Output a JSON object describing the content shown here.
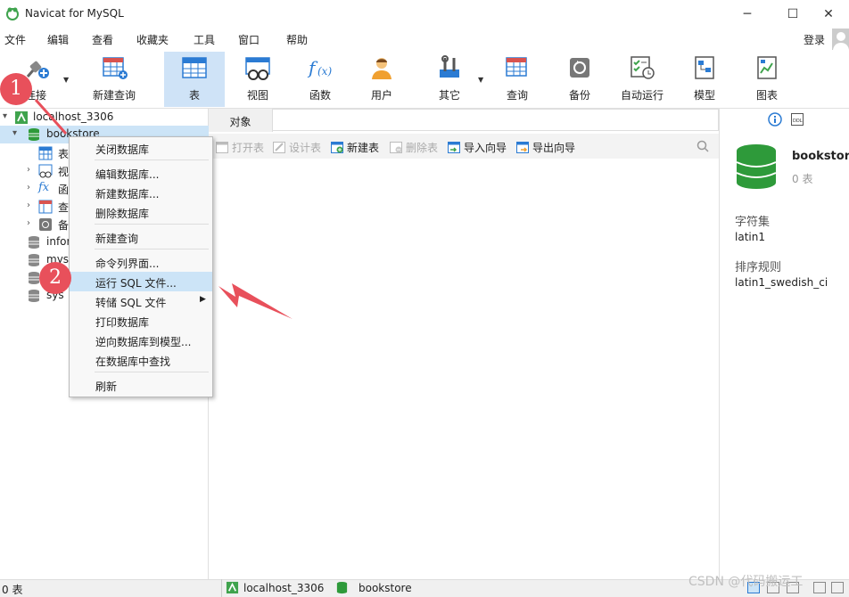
{
  "window": {
    "title": "Navicat for MySQL",
    "minimize": "─",
    "maximize": "☐",
    "close": "✕"
  },
  "menu": [
    "文件",
    "编辑",
    "查看",
    "收藏夹",
    "工具",
    "窗口",
    "帮助"
  ],
  "login": "登录",
  "toolbar": {
    "connect": "连接",
    "new_query": "新建查询",
    "table": "表",
    "view": "视图",
    "function": "函数",
    "user": "用户",
    "other": "其它",
    "query": "查询",
    "backup": "备份",
    "autorun": "自动运行",
    "model": "模型",
    "chart": "图表"
  },
  "tree": {
    "connection": "localhost_3306",
    "db": "bookstore",
    "children": [
      "表",
      "视",
      "函",
      "查",
      "备"
    ],
    "others": [
      "infor",
      "mys",
      "",
      "sys"
    ]
  },
  "tabs": {
    "objects": "对象"
  },
  "objbar": {
    "open": "打开表",
    "design": "设计表",
    "new": "新建表",
    "delete": "删除表",
    "import": "导入向导",
    "export": "导出向导"
  },
  "context_menu": [
    "关闭数据库",
    "编辑数据库...",
    "新建数据库...",
    "删除数据库",
    "新建查询",
    "命令列界面...",
    "运行 SQL 文件...",
    "转储 SQL 文件",
    "打印数据库",
    "逆向数据库到模型...",
    "在数据库中查找",
    "刷新"
  ],
  "right_panel": {
    "name": "bookstor.",
    "count": "0 表",
    "charset_label": "字符集",
    "charset": "latin1",
    "collation_label": "排序规则",
    "collation": "latin1_swedish_ci"
  },
  "status": {
    "tables": "0 表",
    "connection": "localhost_3306",
    "db": "bookstore"
  },
  "badges": {
    "one": "1",
    "two": "2"
  },
  "watermark": "CSDN @代码搬运工",
  "colors": {
    "badge": "#e8505b",
    "selection": "#cce4f7",
    "active_tab": "#cfe3f7",
    "db_green": "#2e9a3a"
  }
}
